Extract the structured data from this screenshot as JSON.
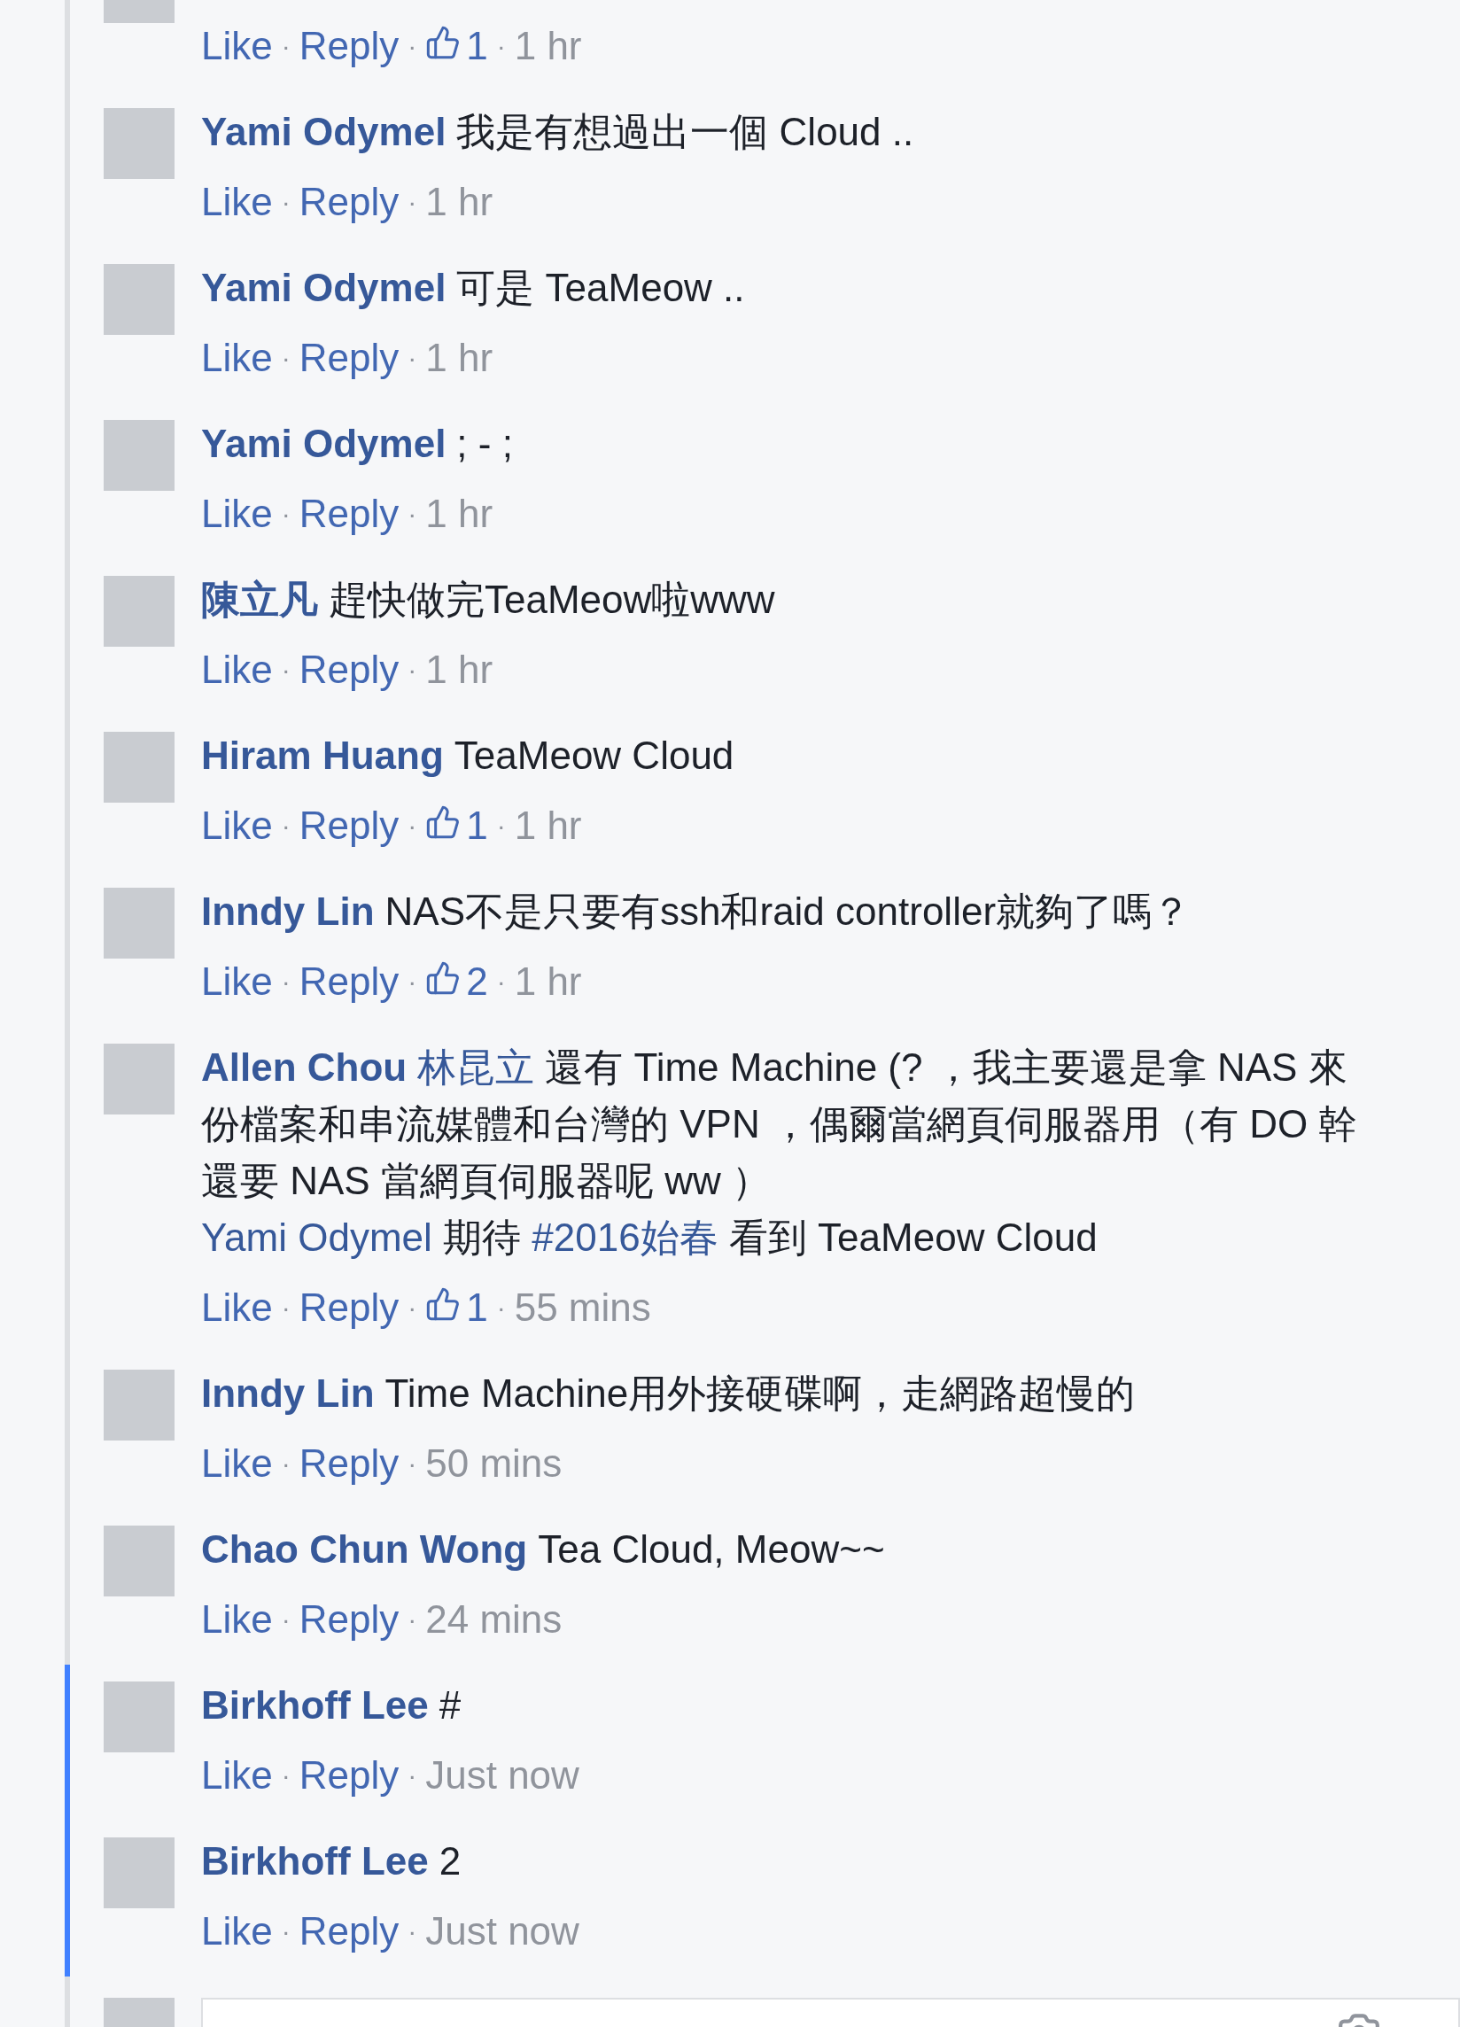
{
  "comments": [
    {
      "highlighted": false,
      "meta": [
        {
          "kind": "link",
          "text": "Like"
        },
        {
          "kind": "dot",
          "text": "·"
        },
        {
          "kind": "link",
          "text": "Reply"
        },
        {
          "kind": "dot",
          "text": "·"
        },
        {
          "kind": "likes",
          "text": "1"
        },
        {
          "kind": "dot",
          "text": "·"
        },
        {
          "kind": "time",
          "text": "1 hr"
        }
      ]
    },
    {
      "author": "Yami Odymel",
      "text_lines": [
        "我是有想過出一個 Cloud .."
      ],
      "highlighted": false,
      "meta": [
        {
          "kind": "link",
          "text": "Like"
        },
        {
          "kind": "dot",
          "text": "·"
        },
        {
          "kind": "link",
          "text": "Reply"
        },
        {
          "kind": "dot",
          "text": "·"
        },
        {
          "kind": "time",
          "text": "1 hr"
        }
      ]
    },
    {
      "author": "Yami Odymel",
      "text_lines": [
        "可是 TeaMeow .."
      ],
      "highlighted": false,
      "meta": [
        {
          "kind": "link",
          "text": "Like"
        },
        {
          "kind": "dot",
          "text": "·"
        },
        {
          "kind": "link",
          "text": "Reply"
        },
        {
          "kind": "dot",
          "text": "·"
        },
        {
          "kind": "time",
          "text": "1 hr"
        }
      ]
    },
    {
      "author": "Yami Odymel",
      "text_lines": [
        "; - ;"
      ],
      "highlighted": false,
      "meta": [
        {
          "kind": "link",
          "text": "Like"
        },
        {
          "kind": "dot",
          "text": "·"
        },
        {
          "kind": "link",
          "text": "Reply"
        },
        {
          "kind": "dot",
          "text": "·"
        },
        {
          "kind": "time",
          "text": "1 hr"
        }
      ]
    },
    {
      "author": "陳立凡",
      "text_lines": [
        "趕快做完TeaMeow啦www"
      ],
      "highlighted": false,
      "meta": [
        {
          "kind": "link",
          "text": "Like"
        },
        {
          "kind": "dot",
          "text": "·"
        },
        {
          "kind": "link",
          "text": "Reply"
        },
        {
          "kind": "dot",
          "text": "·"
        },
        {
          "kind": "time",
          "text": "1 hr"
        }
      ]
    },
    {
      "author": "Hiram Huang",
      "text_lines": [
        "TeaMeow Cloud"
      ],
      "highlighted": false,
      "meta": [
        {
          "kind": "link",
          "text": "Like"
        },
        {
          "kind": "dot",
          "text": "·"
        },
        {
          "kind": "link",
          "text": "Reply"
        },
        {
          "kind": "dot",
          "text": "·"
        },
        {
          "kind": "likes",
          "text": "1"
        },
        {
          "kind": "dot",
          "text": "·"
        },
        {
          "kind": "time",
          "text": "1 hr"
        }
      ]
    },
    {
      "author": "Inndy Lin",
      "text_lines": [
        "NAS不是只要有ssh和raid controller就夠了嗎？"
      ],
      "highlighted": false,
      "meta": [
        {
          "kind": "link",
          "text": "Like"
        },
        {
          "kind": "dot",
          "text": "·"
        },
        {
          "kind": "link",
          "text": "Reply"
        },
        {
          "kind": "dot",
          "text": "·"
        },
        {
          "kind": "likes",
          "text": "2"
        },
        {
          "kind": "dot",
          "text": "·"
        },
        {
          "kind": "time",
          "text": "1 hr"
        }
      ]
    },
    {
      "author": "Allen Chou",
      "author_alt": "林昆立",
      "text_lines": [
        "還有 Time Machine (? ，我主要還是拿 NAS 來",
        "份檔案和串流媒體和台灣的 VPN ，偶爾當網頁伺服器用（有 DO 幹",
        "還要 NAS 當網頁伺服器呢 ww ）"
      ],
      "extra_line": [
        {
          "kind": "mention",
          "text": "Yami Odymel"
        },
        {
          "kind": "text",
          "text": "期待"
        },
        {
          "kind": "hashtag",
          "text": "#2016始春"
        },
        {
          "kind": "text",
          "text": "看到 TeaMeow Cloud"
        }
      ],
      "highlighted": false,
      "meta": [
        {
          "kind": "link",
          "text": "Like"
        },
        {
          "kind": "dot",
          "text": "·"
        },
        {
          "kind": "link",
          "text": "Reply"
        },
        {
          "kind": "dot",
          "text": "·"
        },
        {
          "kind": "likes",
          "text": "1"
        },
        {
          "kind": "dot",
          "text": "·"
        },
        {
          "kind": "time",
          "text": "55 mins"
        }
      ]
    },
    {
      "author": "Inndy Lin",
      "text_lines": [
        "Time Machine用外接硬碟啊，走網路超慢的"
      ],
      "highlighted": false,
      "meta": [
        {
          "kind": "link",
          "text": "Like"
        },
        {
          "kind": "dot",
          "text": "·"
        },
        {
          "kind": "link",
          "text": "Reply"
        },
        {
          "kind": "dot",
          "text": "·"
        },
        {
          "kind": "time",
          "text": "50 mins"
        }
      ]
    },
    {
      "author": "Chao Chun Wong",
      "text_lines": [
        "Tea Cloud, Meow~~"
      ],
      "highlighted": false,
      "meta": [
        {
          "kind": "link",
          "text": "Like"
        },
        {
          "kind": "dot",
          "text": "·"
        },
        {
          "kind": "link",
          "text": "Reply"
        },
        {
          "kind": "dot",
          "text": "·"
        },
        {
          "kind": "time",
          "text": "24 mins"
        }
      ]
    },
    {
      "author": "Birkhoff Lee",
      "text_lines": [
        "#"
      ],
      "highlighted": true,
      "meta": [
        {
          "kind": "link",
          "text": "Like"
        },
        {
          "kind": "dot",
          "text": "·"
        },
        {
          "kind": "link",
          "text": "Reply"
        },
        {
          "kind": "dot",
          "text": "·"
        },
        {
          "kind": "time",
          "text": "Just now"
        }
      ]
    },
    {
      "author": "Birkhoff Lee",
      "text_lines": [
        "2"
      ],
      "highlighted": true,
      "meta": [
        {
          "kind": "link",
          "text": "Like"
        },
        {
          "kind": "dot",
          "text": "·"
        },
        {
          "kind": "link",
          "text": "Reply"
        },
        {
          "kind": "dot",
          "text": "·"
        },
        {
          "kind": "time",
          "text": "Just now"
        }
      ]
    }
  ]
}
